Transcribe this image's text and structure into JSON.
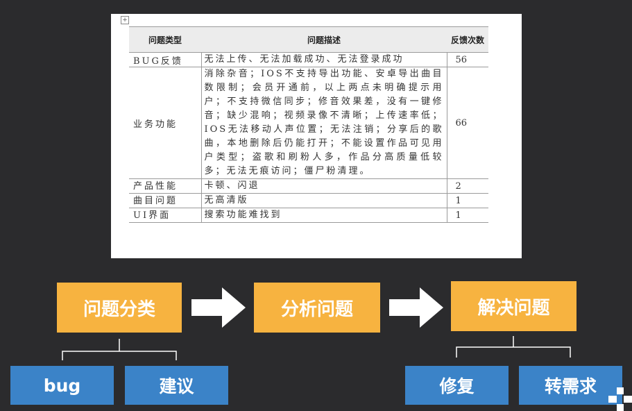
{
  "table": {
    "headers": [
      "问题类型",
      "问题描述",
      "反馈次数"
    ],
    "rows": [
      {
        "type": "BUG反馈",
        "desc": "无法上传、无法加载成功、无法登录成功",
        "count": "56"
      },
      {
        "type": "业务功能",
        "desc": "消除杂音；IOS不支持导出功能、安卓导出曲目数限制；会员开通前，以上两点未明确提示用户；不支持微信同步；修音效果差，没有一键修音；缺少混响；视频录像不清晰；上传速率低；IOS无法移动人声位置；无法注销；分享后的歌曲，本地删除后仍能打开；不能设置作品可见用户类型；盗歌和刷粉人多，作品分高质量低较多；无法无痕访问；僵尸粉清理。",
        "count": "66"
      },
      {
        "type": "产品性能",
        "desc": "卡顿、闪退",
        "count": "2"
      },
      {
        "type": "曲目问题",
        "desc": "无高清版",
        "count": "1"
      },
      {
        "type": "UI界面",
        "desc": "搜索功能难找到",
        "count": "1"
      }
    ]
  },
  "flow": {
    "steps": [
      "问题分类",
      "分析问题",
      "解决问题"
    ],
    "classify_children": [
      "bug",
      "建议"
    ],
    "solve_children": [
      "修复",
      "转需求"
    ]
  },
  "colors": {
    "background": "#2b2b2d",
    "step_box": "#f7b340",
    "child_box": "#3b83c8"
  }
}
